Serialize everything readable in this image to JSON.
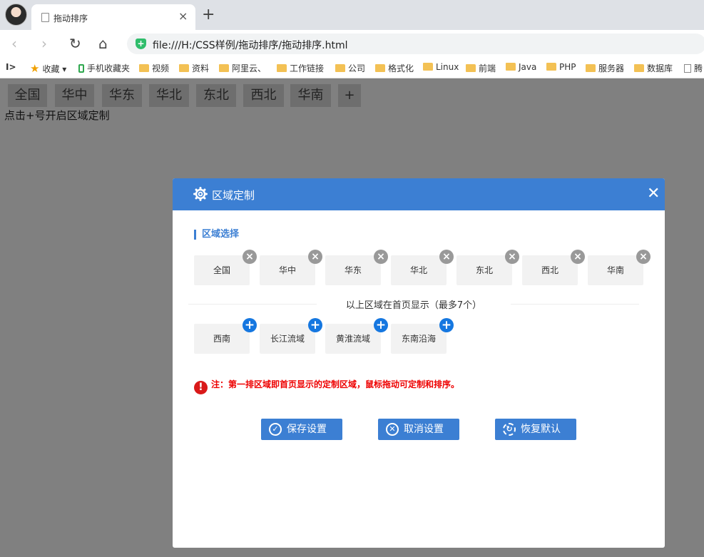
{
  "browser": {
    "tab_title": "拖动排序",
    "tab_close": "×",
    "new_tab": "+",
    "address": "file:///H:/CSS样例/拖动排序/拖动排序.html",
    "nav": {
      "back": "‹",
      "forward": "›",
      "reload": "↻",
      "home": "⌂"
    },
    "bookmarks": [
      {
        "label": "收藏",
        "icon": "star-icon"
      },
      {
        "label": "手机收藏夹",
        "icon": "phone-icon"
      },
      {
        "label": "视频",
        "icon": "folder-icon"
      },
      {
        "label": "资料",
        "icon": "folder-icon"
      },
      {
        "label": "阿里云、",
        "icon": "folder-icon"
      },
      {
        "label": "工作链接",
        "icon": "folder-icon"
      },
      {
        "label": "公司",
        "icon": "folder-icon"
      },
      {
        "label": "格式化",
        "icon": "folder-icon"
      },
      {
        "label": "Linux",
        "icon": "folder-icon"
      },
      {
        "label": "前端",
        "icon": "folder-icon"
      },
      {
        "label": "Java",
        "icon": "folder-icon"
      },
      {
        "label": "PHP",
        "icon": "folder-icon"
      },
      {
        "label": "服务器",
        "icon": "folder-icon"
      },
      {
        "label": "数据库",
        "icon": "folder-icon"
      },
      {
        "label": "腾",
        "icon": "doc-icon"
      }
    ]
  },
  "page": {
    "regions": [
      "全国",
      "华中",
      "华东",
      "华北",
      "东北",
      "西北",
      "华南",
      "+"
    ],
    "hint": "点击+号开启区域定制"
  },
  "dialog": {
    "title": "区域定制",
    "close": "✕",
    "section_title": "区域选择",
    "selected": [
      "全国",
      "华中",
      "华东",
      "华北",
      "东北",
      "西北",
      "华南"
    ],
    "divider_text": "以上区域在首页显示（最多7个）",
    "available": [
      "西南",
      "长江流域",
      "黄淮流域",
      "东南沿海"
    ],
    "notice": "注：第一排区域即首页显示的定制区域，鼠标拖动可定制和排序。",
    "buttons": {
      "save": "保存设置",
      "cancel": "取消设置",
      "reset": "恢复默认"
    },
    "colors": {
      "accent": "#3c7fd3",
      "add": "#1577e0",
      "warning": "#e00000"
    }
  }
}
